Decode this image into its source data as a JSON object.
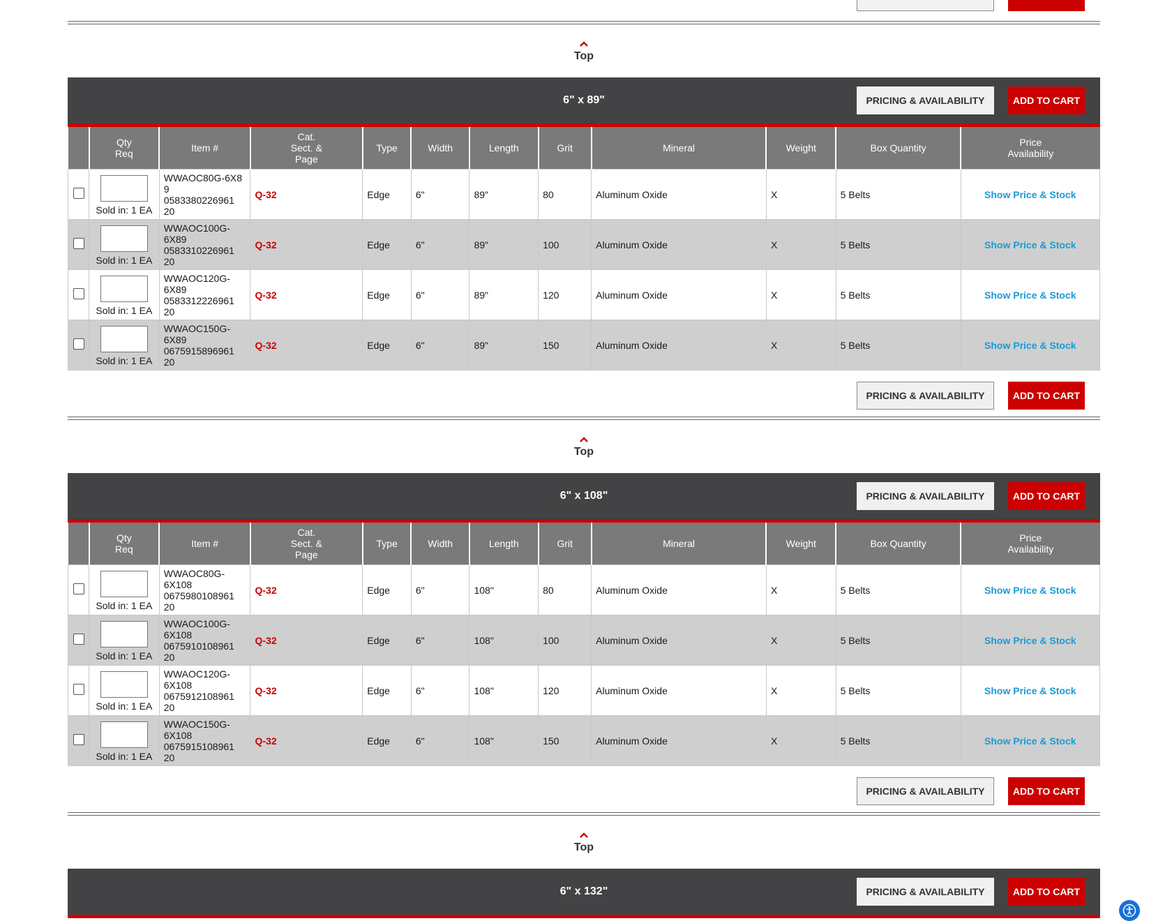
{
  "top_link_label": "Top",
  "buttons": {
    "pricing": "PRICING & AVAILABILITY",
    "cart": "ADD TO CART"
  },
  "columns": [
    "",
    "Qty\nReq",
    "Item #",
    "Cat.\nSect. &\nPage",
    "Type",
    "Width",
    "Length",
    "Grit",
    "Mineral",
    "Weight",
    "Box Quantity",
    "Price\nAvailability"
  ],
  "sections": [
    {
      "title": "6\" x 89\"",
      "rows": [
        {
          "item": "WWAOC80G-6X89\n0583380226961\n20",
          "sold": "Sold in: 1 EA",
          "cat": "Q-32",
          "type": "Edge",
          "width": "6\"",
          "length": "89\"",
          "grit": "80",
          "mineral": "Aluminum Oxide",
          "weight": "X",
          "box": "5 Belts",
          "price": "Show Price & Stock"
        },
        {
          "item": "WWAOC100G-\n6X89\n0583310226961\n20",
          "sold": "Sold in: 1 EA",
          "cat": "Q-32",
          "type": "Edge",
          "width": "6\"",
          "length": "89\"",
          "grit": "100",
          "mineral": "Aluminum Oxide",
          "weight": "X",
          "box": "5 Belts",
          "price": "Show Price & Stock"
        },
        {
          "item": "WWAOC120G-\n6X89\n0583312226961\n20",
          "sold": "Sold in: 1 EA",
          "cat": "Q-32",
          "type": "Edge",
          "width": "6\"",
          "length": "89\"",
          "grit": "120",
          "mineral": "Aluminum Oxide",
          "weight": "X",
          "box": "5 Belts",
          "price": "Show Price & Stock"
        },
        {
          "item": "WWAOC150G-\n6X89\n0675915896961\n20",
          "sold": "Sold in: 1 EA",
          "cat": "Q-32",
          "type": "Edge",
          "width": "6\"",
          "length": "89\"",
          "grit": "150",
          "mineral": "Aluminum Oxide",
          "weight": "X",
          "box": "5 Belts",
          "price": "Show Price & Stock"
        }
      ]
    },
    {
      "title": "6\" x 108\"",
      "rows": [
        {
          "item": "WWAOC80G-\n6X108\n0675980108961\n20",
          "sold": "Sold in: 1 EA",
          "cat": "Q-32",
          "type": "Edge",
          "width": "6\"",
          "length": "108\"",
          "grit": "80",
          "mineral": "Aluminum Oxide",
          "weight": "X",
          "box": "5 Belts",
          "price": "Show Price & Stock"
        },
        {
          "item": "WWAOC100G-\n6X108\n0675910108961\n20",
          "sold": "Sold in: 1 EA",
          "cat": "Q-32",
          "type": "Edge",
          "width": "6\"",
          "length": "108\"",
          "grit": "100",
          "mineral": "Aluminum Oxide",
          "weight": "X",
          "box": "5 Belts",
          "price": "Show Price & Stock"
        },
        {
          "item": "WWAOC120G-\n6X108\n0675912108961\n20",
          "sold": "Sold in: 1 EA",
          "cat": "Q-32",
          "type": "Edge",
          "width": "6\"",
          "length": "108\"",
          "grit": "120",
          "mineral": "Aluminum Oxide",
          "weight": "X",
          "box": "5 Belts",
          "price": "Show Price & Stock"
        },
        {
          "item": "WWAOC150G-\n6X108\n0675915108961\n20",
          "sold": "Sold in: 1 EA",
          "cat": "Q-32",
          "type": "Edge",
          "width": "6\"",
          "length": "108\"",
          "grit": "150",
          "mineral": "Aluminum Oxide",
          "weight": "X",
          "box": "5 Belts",
          "price": "Show Price & Stock"
        }
      ]
    }
  ],
  "next_section_title": "6\" x 132\"",
  "colors": {
    "header_bg": "#434345",
    "accent_red": "#cc0000",
    "link_blue": "#1a9ad6",
    "column_head_bg": "#7a7a7a",
    "alt_row_bg": "#cfcfcf"
  },
  "icons": {
    "top": "chevron-up-icon",
    "accessibility": "accessibility-icon"
  }
}
